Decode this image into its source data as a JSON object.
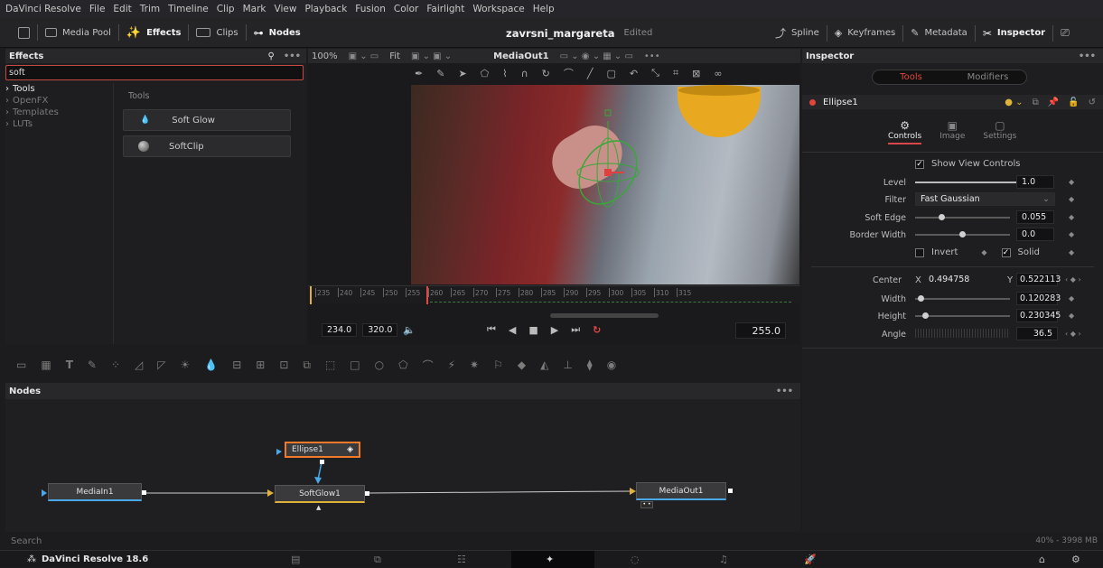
{
  "menubar": {
    "app": "DaVinci Resolve",
    "items": [
      "File",
      "Edit",
      "Trim",
      "Timeline",
      "Clip",
      "Mark",
      "View",
      "Playback",
      "Fusion",
      "Color",
      "Fairlight",
      "Workspace",
      "Help"
    ]
  },
  "toolbar": {
    "media_pool": "Media Pool",
    "effects": "Effects",
    "clips": "Clips",
    "nodes": "Nodes",
    "project": "zavrsni_margareta",
    "status": "Edited",
    "spline": "Spline",
    "keyframes": "Keyframes",
    "metadata": "Metadata",
    "inspector": "Inspector"
  },
  "effects": {
    "title": "Effects",
    "search_value": "soft",
    "tree": [
      "Tools",
      "OpenFX",
      "Templates",
      "LUTs"
    ],
    "category": "Tools",
    "results": [
      "Soft Glow",
      "SoftClip"
    ]
  },
  "viewer": {
    "zoom": "100%",
    "fit": "Fit",
    "output": "MediaOut1",
    "ruler": [
      "235",
      "240",
      "245",
      "250",
      "255",
      "260",
      "265",
      "270",
      "275",
      "280",
      "285",
      "290",
      "295",
      "300",
      "305",
      "310",
      "315"
    ],
    "in_point": "234.0",
    "out_point": "320.0",
    "current_frame": "255.0"
  },
  "nodes": {
    "title": "Nodes",
    "items": {
      "media_in": "MediaIn1",
      "soft_glow": "SoftGlow1",
      "ellipse": "Ellipse1",
      "media_out": "MediaOut1"
    }
  },
  "inspector": {
    "title": "Inspector",
    "tabs": [
      "Tools",
      "Modifiers"
    ],
    "node_name": "Ellipse1",
    "subtabs": [
      "Controls",
      "Image",
      "Settings"
    ],
    "show_view_controls": "Show View Controls",
    "level_label": "Level",
    "level": "1.0",
    "filter_label": "Filter",
    "filter": "Fast Gaussian",
    "soft_edge_label": "Soft Edge",
    "soft_edge": "0.055",
    "border_width_label": "Border Width",
    "border_width": "0.0",
    "invert": "Invert",
    "solid": "Solid",
    "center_label": "Center",
    "x_label": "X",
    "y_label": "Y",
    "center_x": "0.494758",
    "center_y": "0.522113",
    "width_label": "Width",
    "width": "0.120283",
    "height_label": "Height",
    "height": "0.230345",
    "angle_label": "Angle",
    "angle": "36.5"
  },
  "status": {
    "search": "Search",
    "memory": "40% - 3998 MB"
  },
  "footer": {
    "app": "DaVinci Resolve 18.6"
  },
  "colors": {
    "accent": "#e0463a",
    "active_tab_underline": "#d9464a",
    "playhead": "#e04848",
    "node_select": "#f07a2a"
  }
}
